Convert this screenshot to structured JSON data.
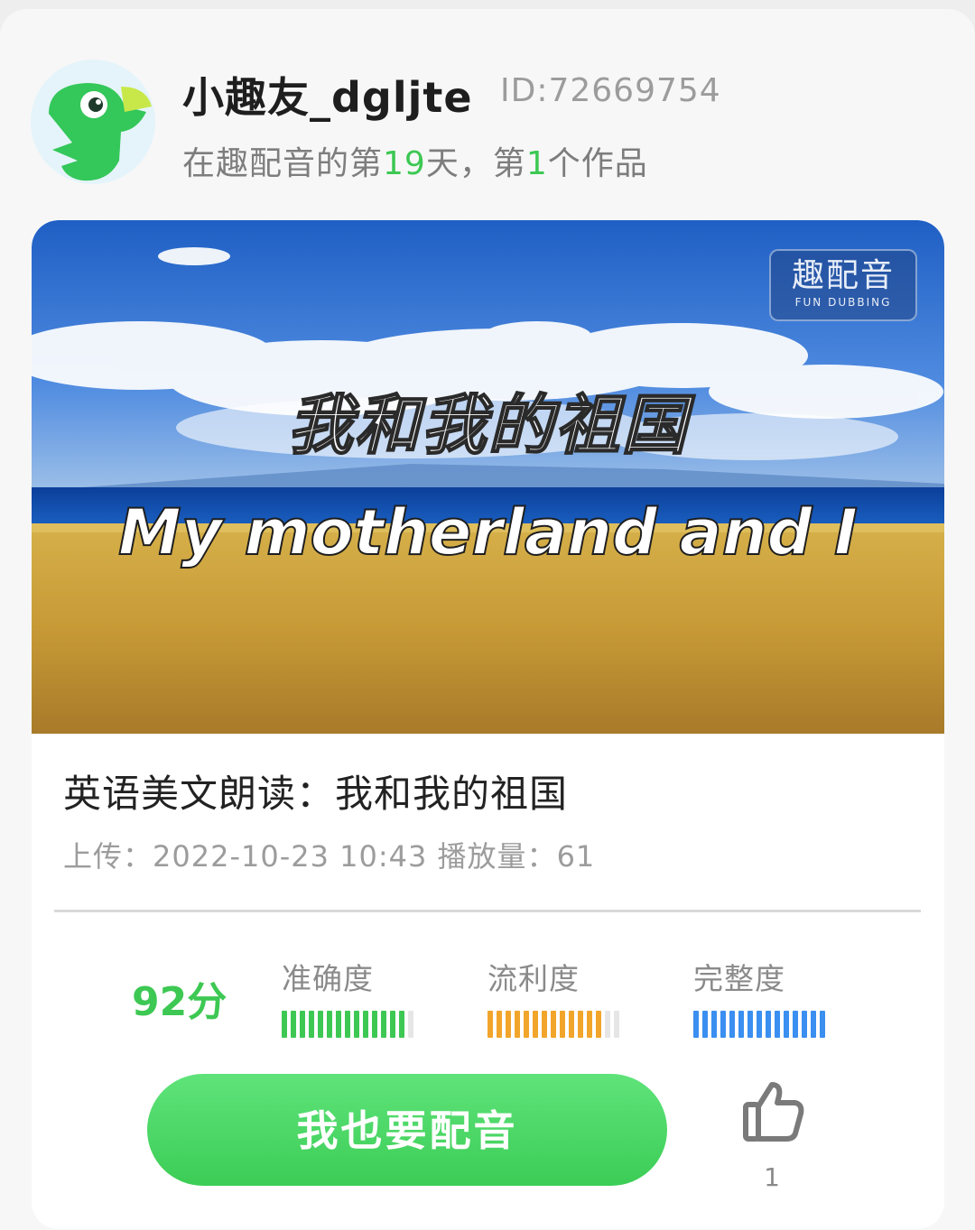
{
  "user": {
    "name": "小趣友_dgljte",
    "id": "ID:72669754",
    "stats_prefix": "在趣配音的第",
    "days": "19",
    "stats_mid": "天，第",
    "works": "1",
    "stats_suffix": "个作品"
  },
  "video": {
    "watermark_cn": "趣配音",
    "watermark_en": "FUN DUBBING",
    "overlay_title_cn": "我和我的祖国",
    "overlay_title_en": "My motherland and I"
  },
  "work": {
    "title": "英语美文朗读：我和我的祖国",
    "upload_label": "上传：",
    "upload_time": "2022-10-23 10:43",
    "plays_label": "播放量：",
    "plays": "61"
  },
  "scores": {
    "total": "92分",
    "metrics": [
      {
        "label": "准确度",
        "color": "#3dc853",
        "level": 0.9
      },
      {
        "label": "流利度",
        "color": "#f2a52b",
        "level": 0.85
      },
      {
        "label": "完整度",
        "color": "#3a8ff0",
        "level": 1.0
      }
    ]
  },
  "actions": {
    "dub_button": "我也要配音",
    "like_count": "1"
  },
  "colors": {
    "brand_green": "#3dc853"
  }
}
